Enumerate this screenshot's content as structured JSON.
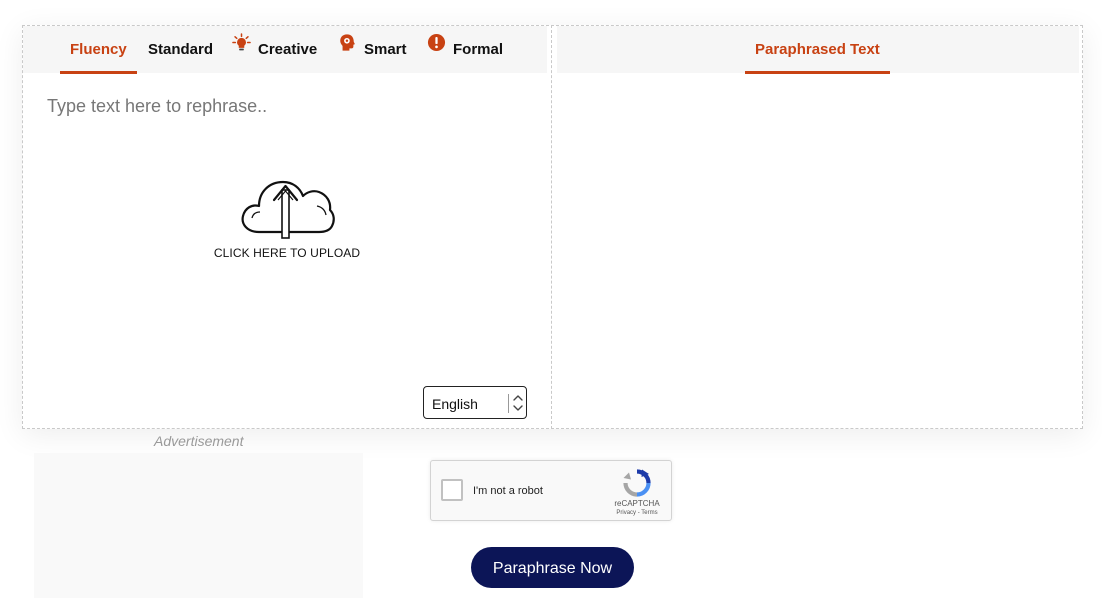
{
  "tabs": [
    {
      "label": "Fluency",
      "active": true,
      "icon": null
    },
    {
      "label": "Standard",
      "active": false,
      "icon": null
    },
    {
      "label": "Creative",
      "active": false,
      "icon": "lightbulb-icon"
    },
    {
      "label": "Smart",
      "active": false,
      "icon": "brain-head-icon"
    },
    {
      "label": "Formal",
      "active": false,
      "icon": "alert-circle-icon"
    }
  ],
  "output": {
    "tab_label": "Paraphrased Text"
  },
  "input": {
    "placeholder": "Type text here to rephrase.."
  },
  "upload": {
    "label": "CLICK HERE TO UPLOAD",
    "icon": "cloud-upload-icon"
  },
  "language": {
    "selected": "English"
  },
  "ad": {
    "label": "Advertisement"
  },
  "captcha": {
    "label": "I'm not a robot",
    "brand": "reCAPTCHA",
    "links": "Privacy - Terms"
  },
  "action": {
    "submit_label": "Paraphrase Now"
  },
  "colors": {
    "accent": "#c84213",
    "button": "#0c1557",
    "panel_header": "#f6f6f6"
  }
}
